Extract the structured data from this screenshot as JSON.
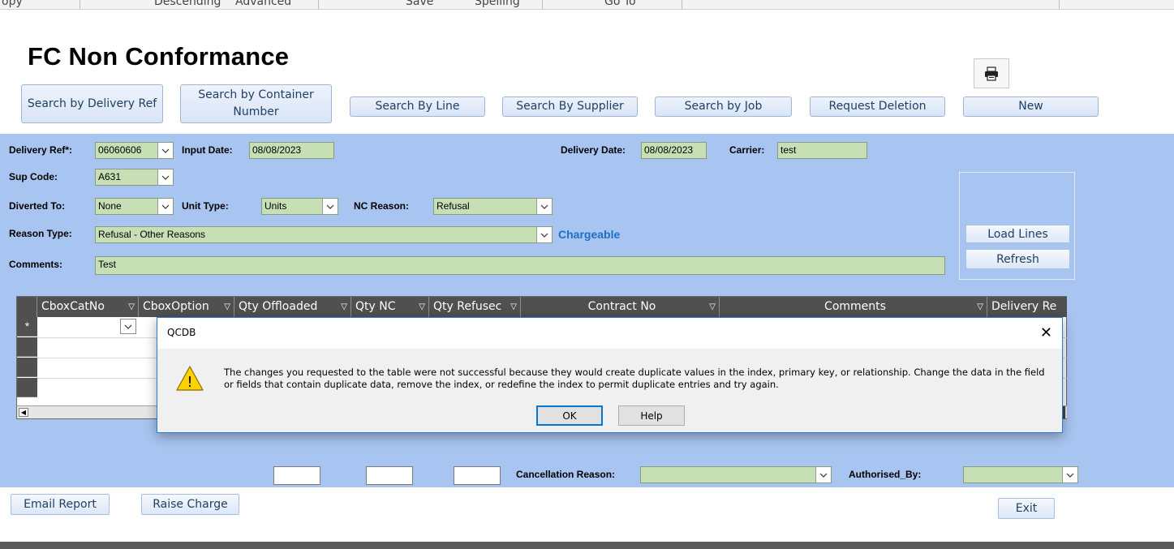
{
  "ribbon": {
    "items": [
      "opy",
      "Descending",
      "Advanced",
      "Save",
      "Spelling",
      "Go To"
    ]
  },
  "form": {
    "title": "FC Non Conformance"
  },
  "toolbar": {
    "search_delivery_ref": "Search by Delivery Ref",
    "search_container": "Search by Container Number",
    "search_line": "Search By Line",
    "search_supplier": "Search By Supplier",
    "search_job": "Search by Job",
    "request_deletion": "Request Deletion",
    "new": "New"
  },
  "fields": {
    "delivery_ref_label": "Delivery Ref*:",
    "delivery_ref_value": "06060606",
    "input_date_label": "Input Date:",
    "input_date_value": "08/08/2023",
    "delivery_date_label": "Delivery Date:",
    "delivery_date_value": "08/08/2023",
    "carrier_label": "Carrier:",
    "carrier_value": "test",
    "sup_code_label": "Sup Code:",
    "sup_code_value": "A631",
    "diverted_to_label": "Diverted To:",
    "diverted_to_value": "None",
    "unit_type_label": "Unit Type:",
    "unit_type_value": "Units",
    "nc_reason_label": "NC Reason:",
    "nc_reason_value": "Refusal",
    "reason_type_label": "Reason Type:",
    "reason_type_value": "Refusal - Other Reasons",
    "chargeable": "Chargeable",
    "comments_label": "Comments:",
    "comments_value": "Test",
    "cancellation_reason_label": "Cancellation  Reason:",
    "authorised_by_label": "Authorised_By:"
  },
  "side": {
    "load_lines": "Load Lines",
    "refresh": "Refresh"
  },
  "grid": {
    "columns": [
      "CboxCatNo",
      "CboxOption",
      "Qty Offloaded",
      "Qty NC",
      "Qty Refusec",
      "Contract No",
      "Comments",
      "Delivery Re"
    ],
    "new_row_marker": "*"
  },
  "dialog": {
    "title": "QCDB",
    "message": "The changes you requested to the table were not successful because they would create duplicate values in the index, primary key, or relationship. Change the data in the field or fields that contain duplicate data, remove the index, or redefine the index to permit duplicate entries and try again.",
    "ok": "OK",
    "help": "Help",
    "close": "✕",
    "warning_glyph": "!"
  },
  "footer": {
    "email_report": "Email Report",
    "raise_charge": "Raise Charge",
    "exit": "Exit"
  },
  "colors": {
    "detail_bg": "#a8c4f0",
    "field_bg": "#c6dfb4",
    "accent": "#1f6fc5",
    "dialog_border": "#2b7cd3"
  }
}
